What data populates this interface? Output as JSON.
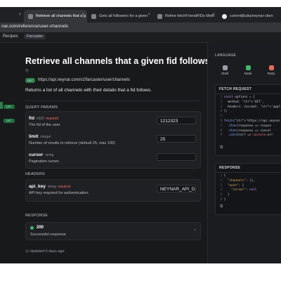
{
  "browser": {
    "tabs": [
      {
        "label": ""
      },
      {
        "label": "Retrieve all channels that a g"
      },
      {
        "label": "Gets all followers for a given"
      },
      {
        "label": "Refine fetchFriendFIDs Meth"
      },
      {
        "label": "commit|liuliu|neynar-clien"
      }
    ],
    "close_glyph": "×",
    "url": "nar.com/reference/user-channels"
  },
  "nav": {
    "left": "Recipes",
    "right": "Farcaster"
  },
  "sidebar": {
    "badges": [
      "GET",
      "GET"
    ]
  },
  "page": {
    "title": "Retrieve all channels that a given fid follows",
    "tag_icon": "⦸",
    "method": "GET",
    "endpoint": "https://api.neynar.com/v2/farcaster/user/channels",
    "description": "Returns a list of all channels with their details that a fid follows.",
    "query_params_label": "QUERY PARAMS",
    "params": [
      {
        "name": "fid",
        "type": "int32",
        "required": "required",
        "desc": "The fid of the user.",
        "value": "1212323"
      },
      {
        "name": "limit",
        "type": "integer",
        "required": "",
        "desc": "Number of results to retrieve (default 25, max 100)",
        "value": "25"
      },
      {
        "name": "cursor",
        "type": "string",
        "required": "",
        "desc": "Pagination cursor.",
        "value": ""
      }
    ],
    "headers_label": "HEADERS",
    "header_param": {
      "name": "api_key",
      "type": "string",
      "required": "required",
      "desc": "API key required for authentication.",
      "value": "NEYNAR_API_DO"
    },
    "response_label": "RESPONSE",
    "response": {
      "code": "200",
      "text": "Successful response",
      "chevron": "›"
    },
    "updated": "Updated 6 days ago"
  },
  "right_panel": {
    "language_label": "LANGUAGE",
    "languages": [
      {
        "name": "Shell",
        "color": "#9aa0a6"
      },
      {
        "name": "Node",
        "color": "#3fb96b"
      },
      {
        "name": "Ruby",
        "color": "#e8695c"
      }
    ],
    "fetch_request_label": "FETCH REQUEST",
    "response_label": "RESPONSE",
    "code_lines": [
      "const options = {",
      "  method: 'GET',",
      "  headers: {accept: 'applic",
      "};",
      "",
      "fetch('https://api.neynar.co",
      "  .then(response => respon",
      "  .then(response => consol",
      "  .catch(err => console.err"
    ],
    "response_lines": [
      "{",
      "  \"channels\": [],",
      "  \"next\": {",
      "    \"cursor\": null",
      "  }",
      "}"
    ],
    "copy_icon": "⧉"
  }
}
